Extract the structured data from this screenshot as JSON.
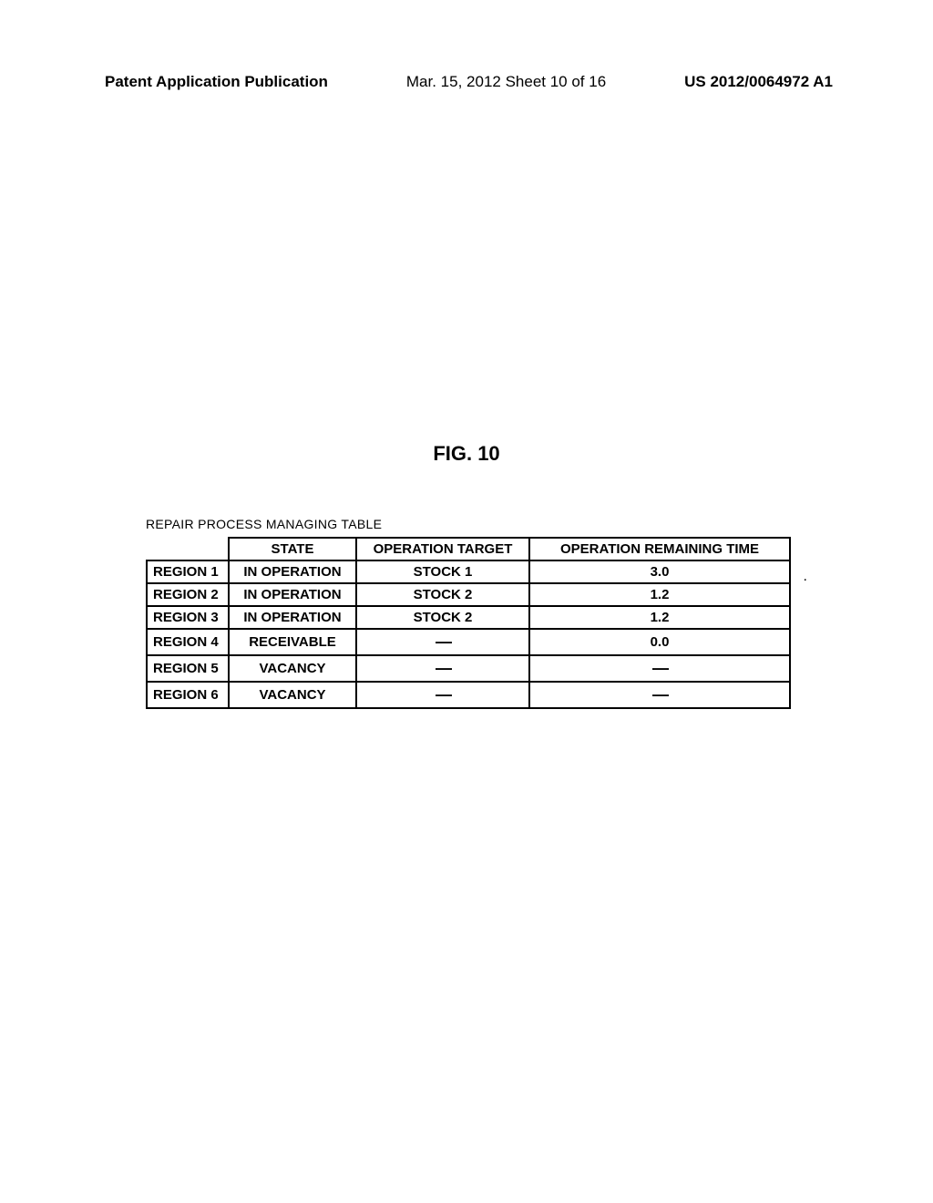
{
  "header": {
    "left": "Patent Application Publication",
    "center": "Mar. 15, 2012  Sheet 10 of 16",
    "right": "US 2012/0064972 A1"
  },
  "figure_label": "FIG. 10",
  "table": {
    "caption": "REPAIR PROCESS MANAGING TABLE",
    "columns": {
      "blank": "",
      "state": "STATE",
      "target": "OPERATION TARGET",
      "time": "OPERATION REMAINING TIME"
    },
    "rows": [
      {
        "region": "REGION 1",
        "state": "IN OPERATION",
        "target": "STOCK 1",
        "time": "3.0"
      },
      {
        "region": "REGION 2",
        "state": "IN OPERATION",
        "target": "STOCK 2",
        "time": "1.2"
      },
      {
        "region": "REGION 3",
        "state": "IN OPERATION",
        "target": "STOCK 2",
        "time": "1.2"
      },
      {
        "region": "REGION 4",
        "state": "RECEIVABLE",
        "target": "—",
        "time": "0.0"
      },
      {
        "region": "REGION 5",
        "state": "VACANCY",
        "target": "—",
        "time": "—"
      },
      {
        "region": "REGION 6",
        "state": "VACANCY",
        "target": "—",
        "time": "—"
      }
    ]
  },
  "period_mark": "."
}
